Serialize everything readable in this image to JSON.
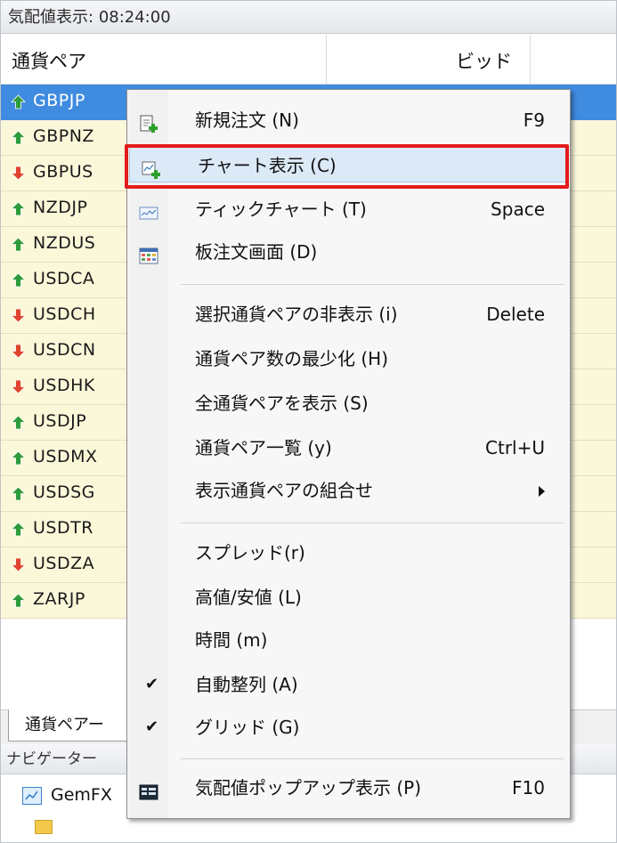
{
  "window": {
    "title_prefix": "気配値表示:",
    "time": "08:24:00"
  },
  "table": {
    "col_pair": "通貨ペア",
    "col_bid": "ビッド",
    "rows": [
      {
        "symbol": "GBPJPY",
        "dir": "up",
        "selected": true
      },
      {
        "symbol": "GBPNZD",
        "dir": "up"
      },
      {
        "symbol": "GBPUSD",
        "dir": "down"
      },
      {
        "symbol": "NZDJPY",
        "dir": "up"
      },
      {
        "symbol": "NZDUSD",
        "dir": "up"
      },
      {
        "symbol": "USDCAD",
        "dir": "up"
      },
      {
        "symbol": "USDCHF",
        "dir": "down"
      },
      {
        "symbol": "USDCNH",
        "dir": "down"
      },
      {
        "symbol": "USDHKD",
        "dir": "down"
      },
      {
        "symbol": "USDJPY",
        "dir": "up"
      },
      {
        "symbol": "USDMXN",
        "dir": "up"
      },
      {
        "symbol": "USDSGD",
        "dir": "up"
      },
      {
        "symbol": "USDTRY",
        "dir": "up"
      },
      {
        "symbol": "USDZAR",
        "dir": "down"
      },
      {
        "symbol": "ZARJPY",
        "dir": "up"
      }
    ],
    "visible_symbols": [
      "GBPJP",
      "GBPNZ",
      "GBPUS",
      "NZDJP",
      "NZDUS",
      "USDCA",
      "USDCH",
      "USDCN",
      "USDHK",
      "USDJP",
      "USDMX",
      "USDSG",
      "USDTR",
      "USDZA",
      "ZARJP"
    ]
  },
  "tabs": {
    "active_label": "通貨ペアー"
  },
  "navigator": {
    "title": "ナビゲーター",
    "item_label": "GemFX"
  },
  "menu": {
    "items": [
      {
        "label": "新規注文 (N)",
        "key": "F9"
      },
      {
        "label": "チャート表示 (C)",
        "key": ""
      },
      {
        "label": "ティックチャート (T)",
        "key": "Space"
      },
      {
        "label": "板注文画面 (D)",
        "key": ""
      },
      {
        "label": "選択通貨ペアの非表示 (i)",
        "key": "Delete"
      },
      {
        "label": "通貨ペア数の最少化 (H)",
        "key": ""
      },
      {
        "label": "全通貨ペアを表示 (S)",
        "key": ""
      },
      {
        "label": "通貨ペア一覧 (y)",
        "key": "Ctrl+U"
      },
      {
        "label": "表示通貨ペアの組合せ",
        "key": ""
      },
      {
        "label": "スプレッド(r)",
        "key": ""
      },
      {
        "label": "高値/安値 (L)",
        "key": ""
      },
      {
        "label": "時間 (m)",
        "key": ""
      },
      {
        "label": "自動整列 (A)",
        "key": ""
      },
      {
        "label": "グリッド (G)",
        "key": ""
      },
      {
        "label": "気配値ポップアップ表示 (P)",
        "key": "F10"
      }
    ],
    "check_mark": "✔"
  },
  "colors": {
    "row_bg": "#fbf7d9",
    "selected_bg": "#3f8be0",
    "up_arrow": "#2e9b3a",
    "down_arrow": "#e0442c",
    "highlight_box": "#e31b1b"
  }
}
